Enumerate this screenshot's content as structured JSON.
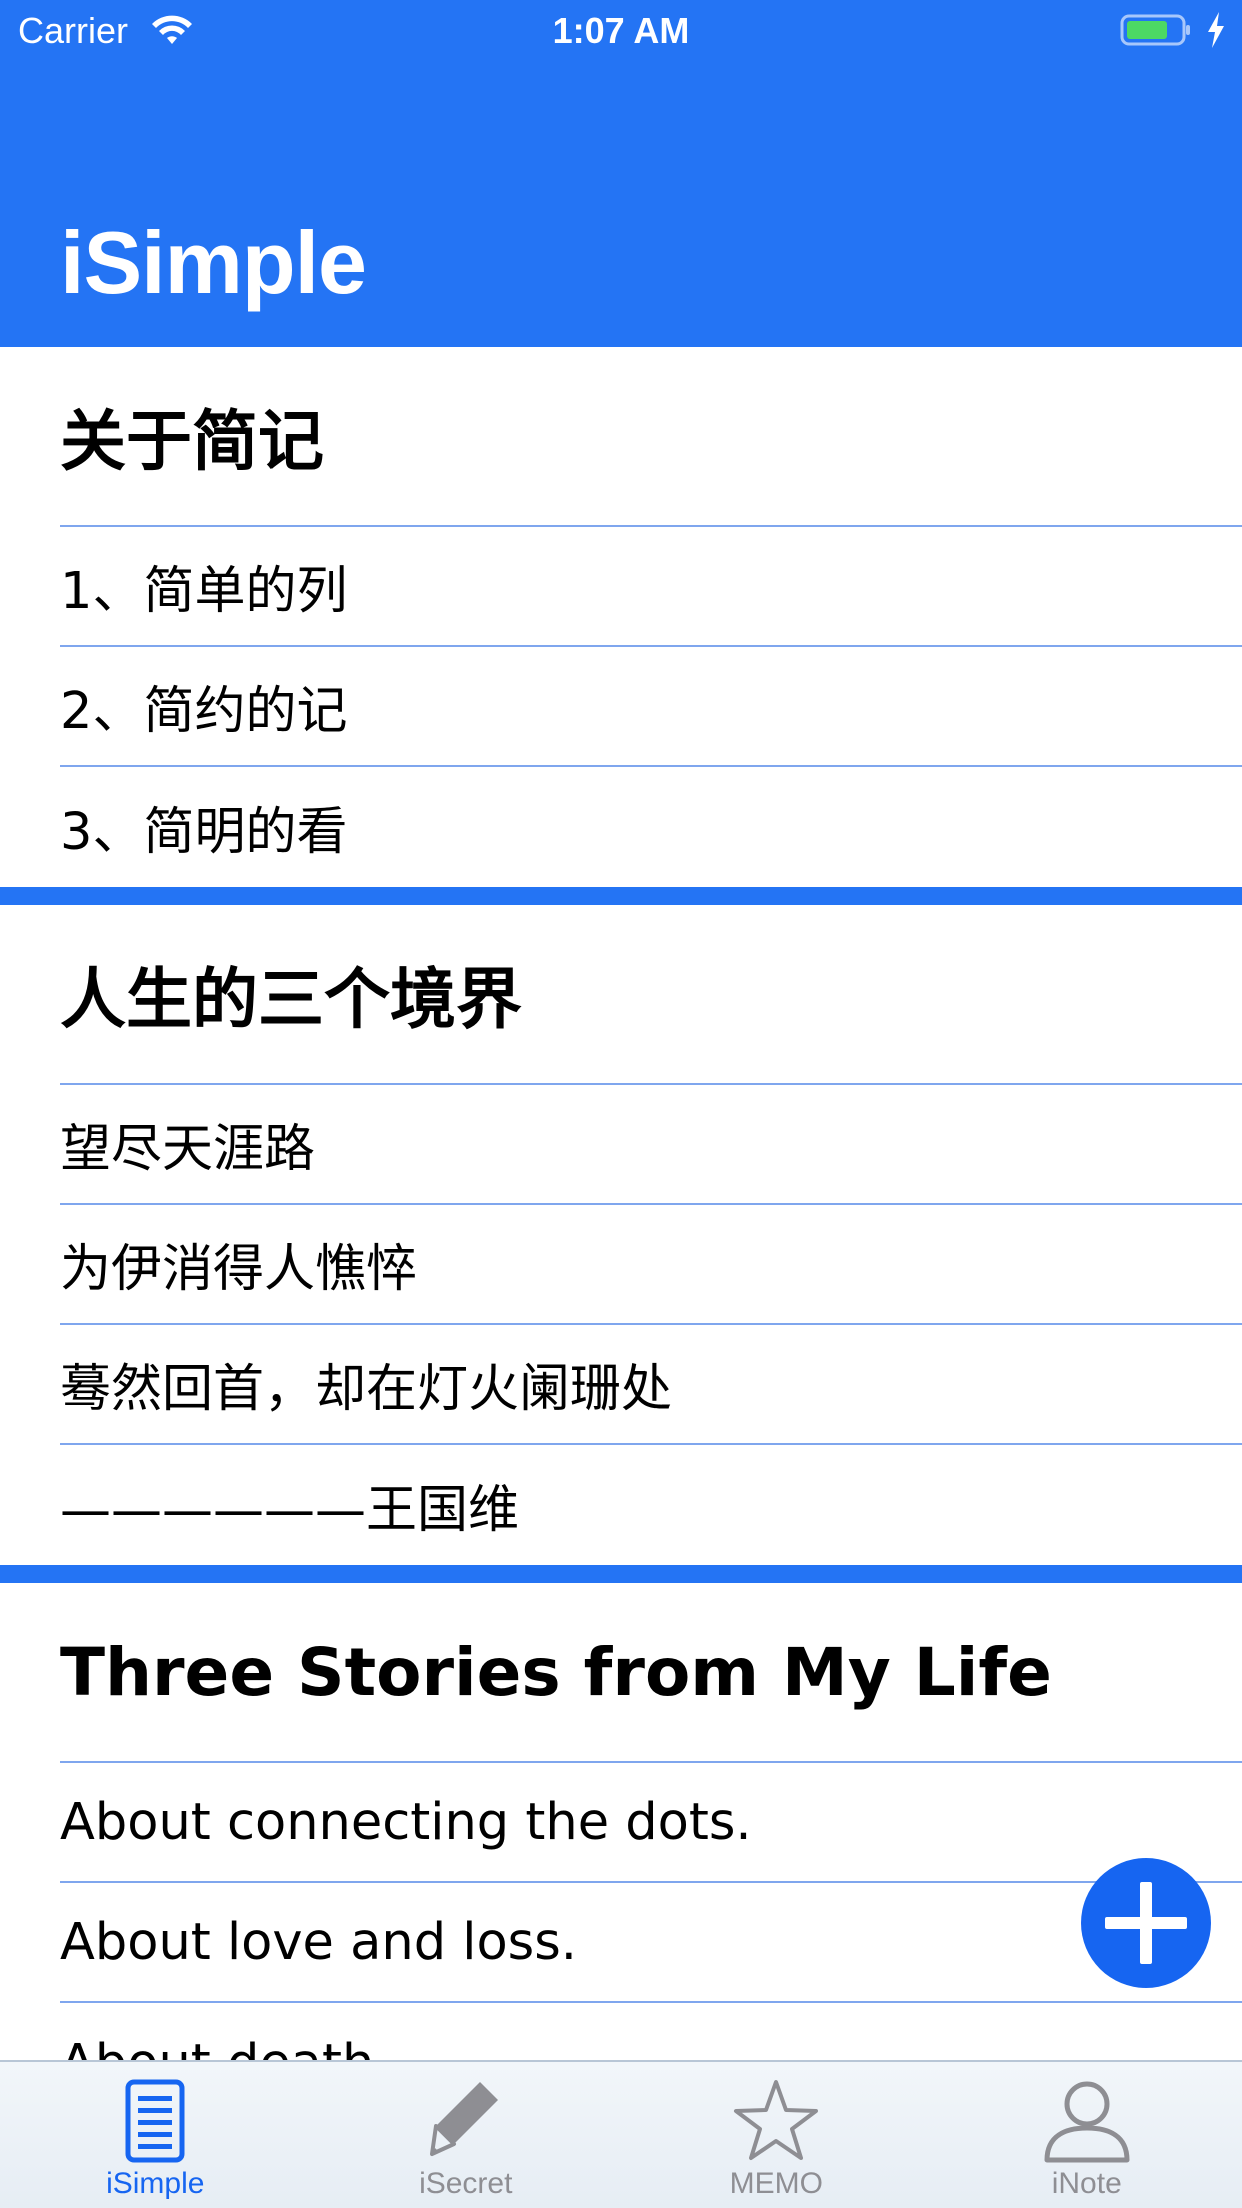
{
  "status_bar": {
    "carrier": "Carrier",
    "time": "1:07 AM",
    "icons": [
      "wifi-icon",
      "battery-icon",
      "charging-icon"
    ]
  },
  "header": {
    "title": "iSimple",
    "background_color": "#2474F4"
  },
  "sections": [
    {
      "title": "关于简记",
      "rows": [
        "1、简单的列",
        "2、简约的记",
        "3、简明的看"
      ]
    },
    {
      "title": "人生的三个境界",
      "rows": [
        "望尽天涯路",
        "为伊消得人憔悴",
        "蓦然回首，却在灯火阑珊处",
        "——————王国维"
      ]
    },
    {
      "title": "Three Stories from My Life",
      "rows": [
        "About connecting the dots.",
        "About love and loss.",
        "About death."
      ]
    }
  ],
  "fab": {
    "icon": "plus-icon",
    "color": "#1665F1"
  },
  "tab_bar": {
    "active_color": "#1665F1",
    "inactive_color": "#8E8E93",
    "tabs": [
      {
        "label": "iSimple",
        "icon": "document-icon",
        "active": true
      },
      {
        "label": "iSecret",
        "icon": "pencil-icon",
        "active": false
      },
      {
        "label": "MEMO",
        "icon": "star-icon",
        "active": false
      },
      {
        "label": "iNote",
        "icon": "person-icon",
        "active": false
      }
    ]
  }
}
